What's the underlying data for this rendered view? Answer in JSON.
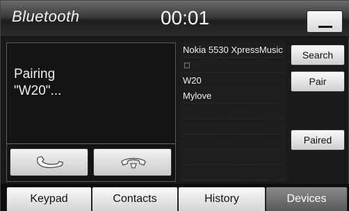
{
  "header": {
    "app_title": "Bluetooth",
    "clock": "00:01",
    "minimize_icon": "minimize-icon"
  },
  "status": {
    "line1": "Pairing",
    "line2": "\"W20\"..."
  },
  "call_buttons": {
    "accept_icon": "phone-handset-icon",
    "hangup_icon": "hang-up-icon"
  },
  "devices": {
    "items": [
      {
        "label": "Nokia 5530 XpressMusic"
      },
      {
        "label": "",
        "icon": "checkbox-icon"
      },
      {
        "label": "W20"
      },
      {
        "label": "Mylove"
      }
    ]
  },
  "actions": {
    "search": "Search",
    "pair": "Pair",
    "paired": "Paired"
  },
  "tabs": [
    {
      "label": "Keypad",
      "active": false
    },
    {
      "label": "Contacts",
      "active": false
    },
    {
      "label": "History",
      "active": false
    },
    {
      "label": "Devices",
      "active": true
    }
  ],
  "colors": {
    "active_tab": "#6e6e6e",
    "button_face": "#e6e6e6",
    "background": "#1a1a1a"
  }
}
